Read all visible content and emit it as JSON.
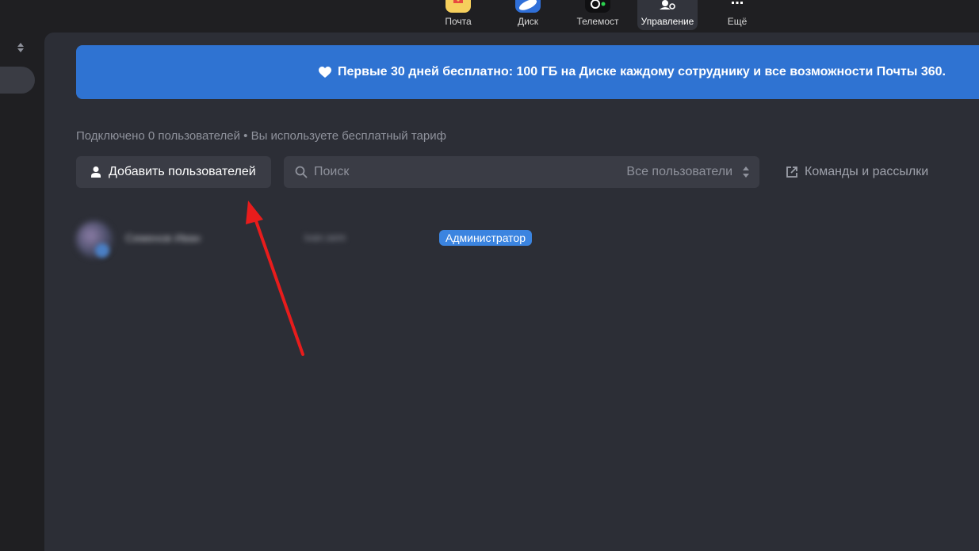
{
  "topnav": {
    "items": [
      {
        "label": "Почта",
        "icon": "mail-icon"
      },
      {
        "label": "Диск",
        "icon": "disk-icon"
      },
      {
        "label": "Телемост",
        "icon": "telemost-icon"
      },
      {
        "label": "Управление",
        "icon": "admin-icon",
        "active": true
      },
      {
        "label": "Ещё",
        "icon": "more-icon"
      }
    ]
  },
  "promo": {
    "text": "Первые 30 дней бесплатно: 100 ГБ на Диске каждому сотруднику и все возможности Почты 360.",
    "icon": "heart-icon",
    "color": "#2f73d2"
  },
  "summary": "Подключено 0 пользователей • Вы используете бесплатный тариф",
  "toolbar": {
    "add_users_label": "Добавить пользователей",
    "search_placeholder": "Поиск",
    "filter_value": "Все пользователи",
    "teams_link_label": "Команды и рассылки"
  },
  "users": [
    {
      "name": "Семенов Иван",
      "login": "ivan.sem",
      "role": "Администратор"
    }
  ],
  "colors": {
    "background": "#1f1f22",
    "panel": "#2c2e36",
    "control": "#3a3c45",
    "role_badge": "#3b84e0",
    "annotation_arrow": "#e81c1c"
  }
}
